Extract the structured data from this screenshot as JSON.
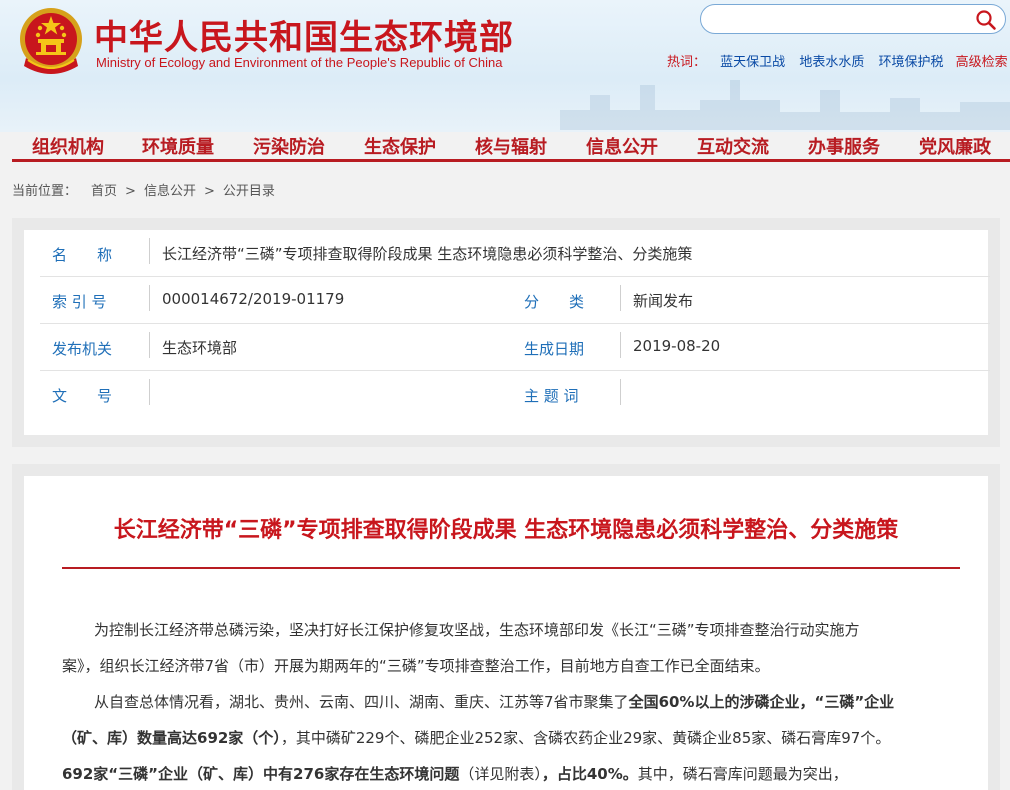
{
  "site": {
    "title_cn": "中华人民共和国生态环境部",
    "title_en": "Ministry of Ecology and Environment of the People's Republic of China"
  },
  "search": {
    "placeholder": "",
    "value": ""
  },
  "hotwords": {
    "label": "热词：",
    "items": [
      "蓝天保卫战",
      "地表水水质",
      "环境保护税"
    ],
    "advanced": "高级检索"
  },
  "nav": {
    "items": [
      "组织机构",
      "环境质量",
      "污染防治",
      "生态保护",
      "核与辐射",
      "信息公开",
      "互动交流",
      "办事服务",
      "党风廉政"
    ]
  },
  "breadcrumb": {
    "label": "当前位置：",
    "items": [
      "首页",
      "信息公开",
      "公开目录"
    ],
    "separator": ">"
  },
  "info": {
    "name_label": "名　　称",
    "name_value": "长江经济带“三磷”专项排查取得阶段成果 生态环境隐患必须科学整治、分类施策",
    "index_label": "索 引 号",
    "index_value": "000014672/2019-01179",
    "category_label": "分　　类",
    "category_value": "新闻发布",
    "org_label": "发布机关",
    "org_value": "生态环境部",
    "date_label": "生成日期",
    "date_value": "2019-08-20",
    "docno_label": "文　　号",
    "docno_value": "",
    "keywords_label": "主 题 词",
    "keywords_value": ""
  },
  "article": {
    "title": "长江经济带“三磷”专项排查取得阶段成果 生态环境隐患必须科学整治、分类施策",
    "p1_l1": "为控制长江经济带总磷污染，坚决打好长江保护修复攻坚战，生态环境部印发《长江“三磷”专项排查整治行动实施方",
    "p1_l2": "案》，组织长江经济带7省（市）开展为期两年的“三磷”专项排查整治工作，目前地方自查工作已全面结束。",
    "p2_l1_a": "从自查总体情况看，湖北、贵州、云南、四川、湖南、重庆、江苏等7省市聚集了",
    "p2_l1_b": "全国60%以上的涉磷企业，“三磷”企业",
    "p2_l2_a": "（矿、库）数量高达692家（个）",
    "p2_l2_b": "，其中磷矿229个、磷肥企业252家、含磷农药企业29家、黄磷企业85家、磷石膏库97个。",
    "p2_l3_a": "692家“三磷”企业（矿、库）中有276家存在生态环境问题",
    "p2_l3_b": "（详见附表）",
    "p2_l3_c": "，占比40%。",
    "p2_l3_d": "其中，磷石膏库问题最为突出，"
  },
  "colors": {
    "brand_red": "#c8161d",
    "nav_red": "#b81c22",
    "label_blue": "#1f6fb8",
    "link_blue": "#0a4aa5"
  },
  "icons": [
    "national-emblem-icon",
    "search-icon"
  ]
}
